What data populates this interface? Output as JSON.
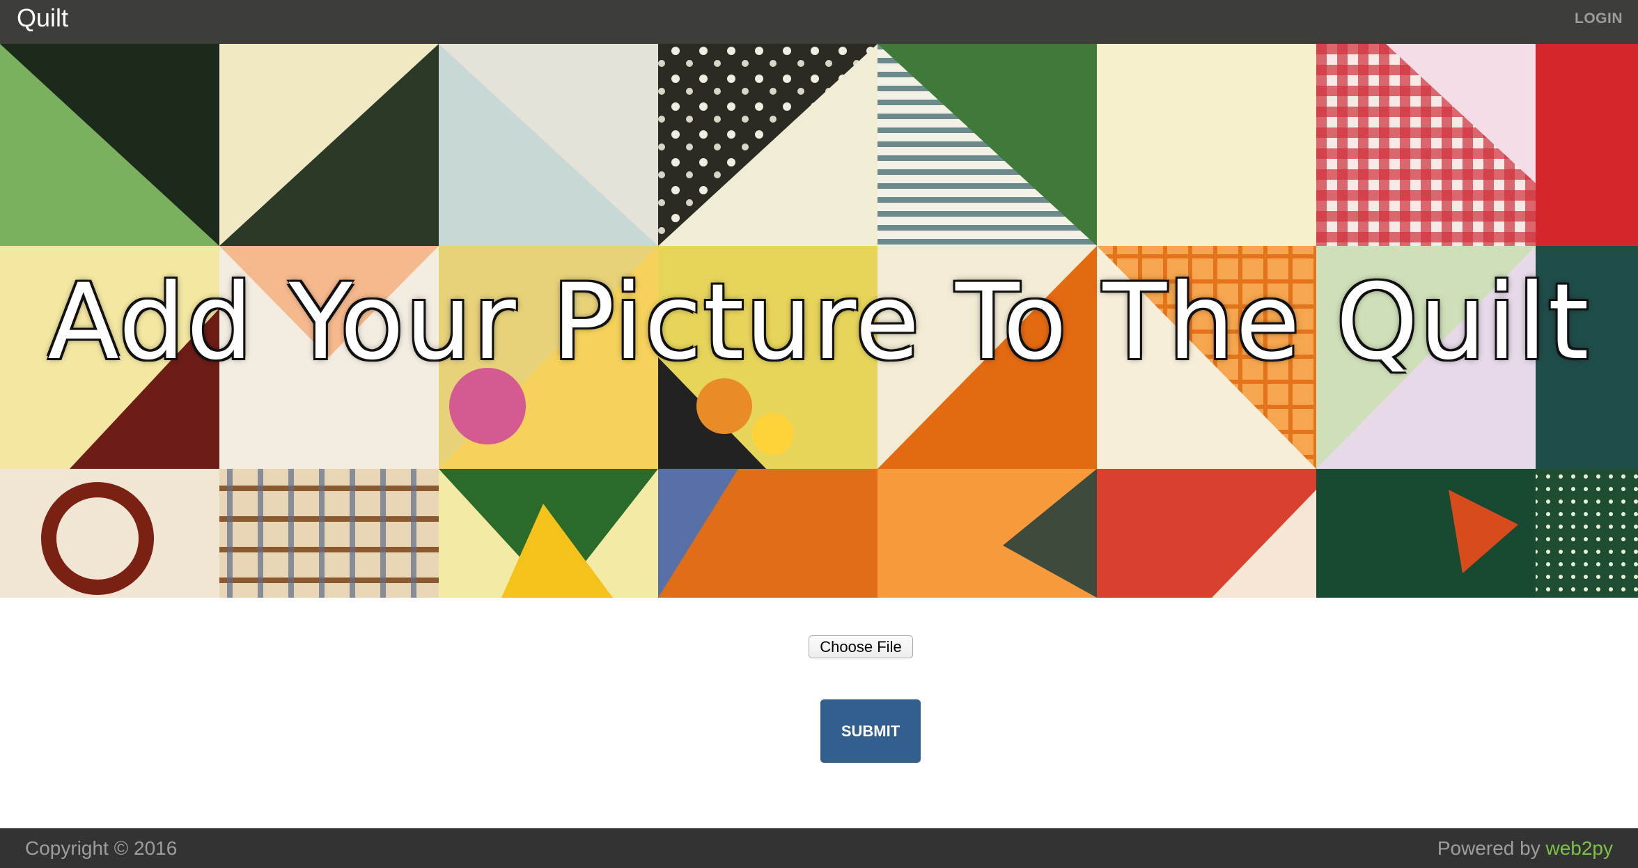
{
  "navbar": {
    "brand": "Quilt",
    "login_label": "LOGIN"
  },
  "hero": {
    "title": "Add Your Picture To The Quilt"
  },
  "form": {
    "file_button_label": "Choose File",
    "submit_label": "SUBMIT"
  },
  "footer": {
    "copyright": "Copyright © 2016",
    "powered_prefix": "Powered by",
    "powered_link": "web2py"
  },
  "colors": {
    "navbar_bg": "#3d3d3a",
    "submit_bg": "#335f8f",
    "footer_bg": "#333333",
    "link_green": "#7cc243"
  }
}
